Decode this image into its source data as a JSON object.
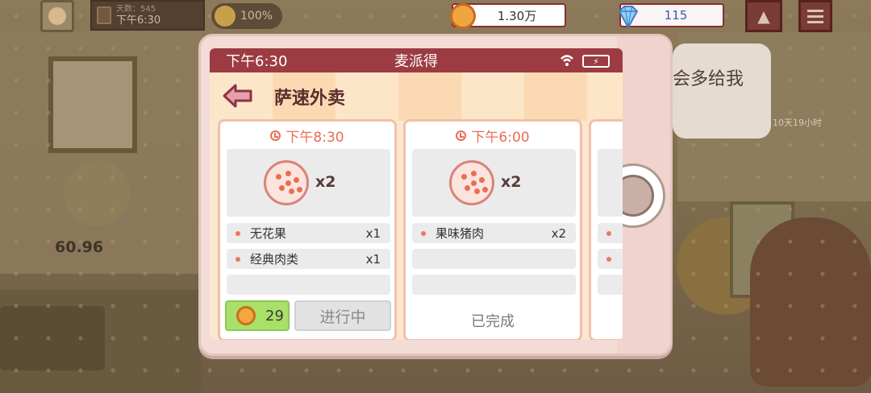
{
  "hud": {
    "days_label": "天数：545",
    "clock": "下午6:30",
    "mood": "100%",
    "coins": "1.30万",
    "gems": "115"
  },
  "scene": {
    "speech_text": "会多给我",
    "timer": "10天19小时",
    "score": "60.96"
  },
  "phone": {
    "status_time": "下午6:30",
    "status_title": "麦派得",
    "page_title": "萨速外卖",
    "orders": [
      {
        "deliver_time": "下午8:30",
        "food_qty": "x2",
        "items": [
          {
            "name": "无花果",
            "count": "x1"
          },
          {
            "name": "经典肉类",
            "count": "x1"
          }
        ],
        "reward": "29",
        "status": "进行中"
      },
      {
        "deliver_time": "下午6:00",
        "food_qty": "x2",
        "items": [
          {
            "name": "果味猪肉",
            "count": "x2"
          }
        ],
        "status": "已完成"
      }
    ]
  },
  "colors": {
    "status_bar": "#9c3c42",
    "accent_orange": "#e96e52",
    "reward_green": "#a8e06a"
  }
}
